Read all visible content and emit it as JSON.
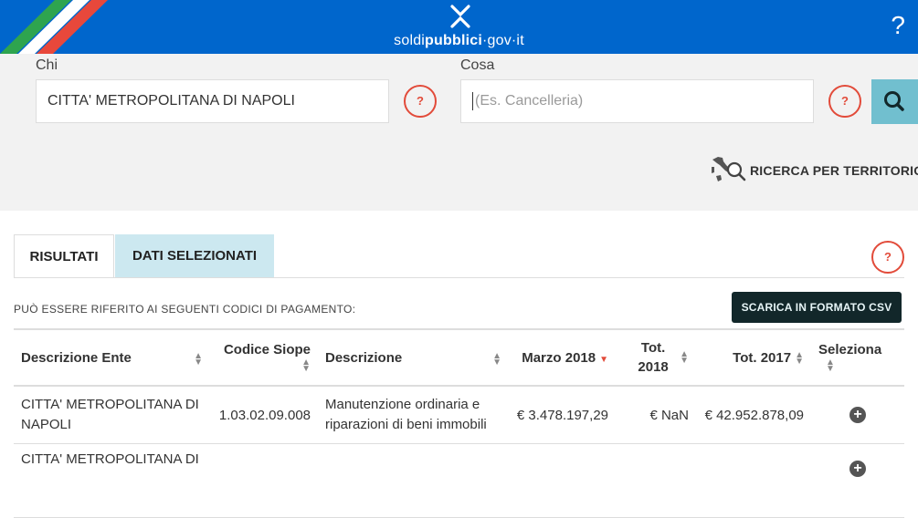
{
  "header": {
    "logo_text_pre": "soldi",
    "logo_text_bold": "pubblici",
    "logo_text_post": "·gov·it",
    "help_label": "?"
  },
  "search": {
    "chi_label": "Chi",
    "chi_value": "CITTA' METROPOLITANA DI NAPOLI",
    "cosa_label": "Cosa",
    "cosa_placeholder": "(Es. Cancelleria)",
    "help_button_label": "?",
    "territorio_label": "RICERCA PER TERRITORIO"
  },
  "tabs": [
    {
      "label": "RISULTATI",
      "active": true
    },
    {
      "label": "DATI SELEZIONATI",
      "active": false
    }
  ],
  "tabs_help_label": "?",
  "results": {
    "subheading": "PUÒ ESSERE RIFERITO AI SEGUENTI CODICI DI PAGAMENTO:",
    "csv_button": "SCARICA IN FORMATO CSV",
    "columns": [
      "Descrizione Ente",
      "Codice Siope",
      "Descrizione",
      "Marzo 2018",
      "Tot. 2018",
      "Tot. 2017",
      "Seleziona"
    ],
    "rows": [
      {
        "ente": "CITTA' METROPOLITANA DI NAPOLI",
        "codice": "1.03.02.09.008",
        "descrizione": "Manutenzione ordinaria e riparazioni di beni immobili",
        "marzo": "€ 3.478.197,29",
        "tot2018": "€ NaN",
        "tot2017": "€ 42.952.878,09"
      },
      {
        "ente": "CITTA' METROPOLITANA DI",
        "codice": "",
        "descrizione": "",
        "marzo": "",
        "tot2018": "",
        "tot2017": ""
      }
    ]
  },
  "colors": {
    "header_bg": "#0066cc",
    "accent_red": "#e24b3a",
    "search_button": "#71bfcf",
    "csv_button": "#12272a",
    "tab_inactive": "#cce8f0"
  }
}
